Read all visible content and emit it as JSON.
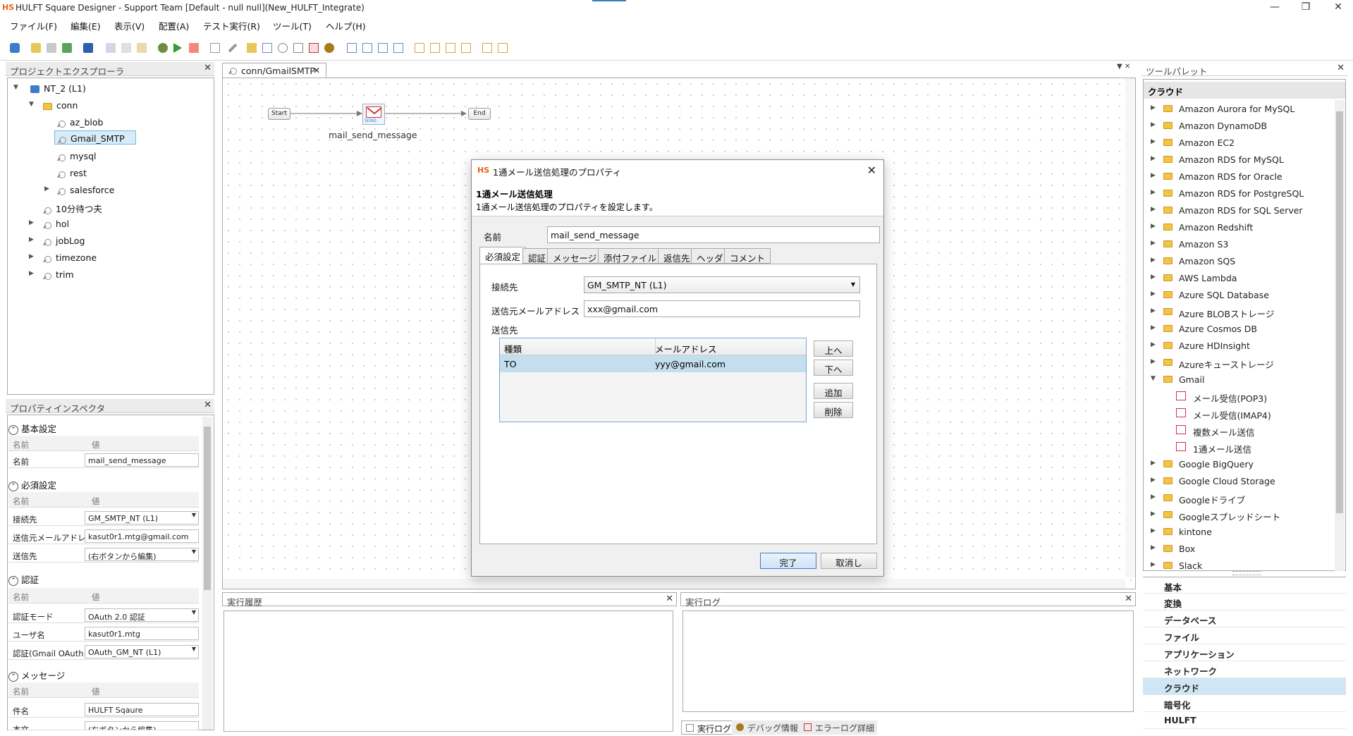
{
  "window": {
    "logo": "HS",
    "title": "HULFT Square Designer - Support Team [Default - null null](New_HULFT_Integrate)"
  },
  "menu": [
    "ファイル(F)",
    "編集(E)",
    "表示(V)",
    "配置(A)",
    "テスト実行(R)",
    "ツール(T)",
    "ヘルプ(H)"
  ],
  "project_explorer": {
    "title": "プロジェクトエクスプローラ",
    "root": "NT_2 (L1)",
    "folder": "conn",
    "children": [
      "az_blob",
      "Gmail_SMTP",
      "mysql",
      "rest",
      "salesforce"
    ],
    "selected": "Gmail_SMTP",
    "others": [
      "10分待つ夫",
      "hol",
      "jobLog",
      "timezone",
      "trim"
    ]
  },
  "inspector": {
    "title": "プロパティインスペクタ",
    "col_name": "名前",
    "col_value": "値",
    "sections": {
      "basic": {
        "title": "基本設定",
        "rows": [
          {
            "k": "名前",
            "v": "mail_send_message"
          }
        ]
      },
      "required": {
        "title": "必須設定",
        "rows": [
          {
            "k": "接続先",
            "v": "GM_SMTP_NT (L1)"
          },
          {
            "k": "送信元メールアドレ",
            "v": "kasut0r1.mtg@gmail.com"
          },
          {
            "k": "送信先",
            "v": "(右ボタンから編集)"
          }
        ]
      },
      "auth": {
        "title": "認証",
        "rows": [
          {
            "k": "認証モード",
            "v": "OAuth 2.0 認証"
          },
          {
            "k": "ユーザ名",
            "v": "kasut0r1.mtg"
          },
          {
            "k": "認証(Gmail OAuth",
            "v": "OAuth_GM_NT (L1)"
          }
        ]
      },
      "message": {
        "title": "メッセージ",
        "rows": [
          {
            "k": "件名",
            "v": "HULFT Sqaure"
          },
          {
            "k": "本文",
            "v": "(右ボタンから編集)"
          }
        ]
      }
    }
  },
  "editor": {
    "tab": "conn/GmailSMTP",
    "flow": {
      "start": "Start",
      "end": "End",
      "node_label": "mail_send_message",
      "node_icon_text": "SEND"
    }
  },
  "bottom": {
    "history_title": "実行履歴",
    "log_title": "実行ログ",
    "tabs": [
      "実行ログ",
      "デバッグ情報",
      "エラーログ詳細"
    ]
  },
  "palette": {
    "title": "ツールパレット",
    "section": "クラウド",
    "items": [
      "Amazon Aurora for MySQL",
      "Amazon DynamoDB",
      "Amazon EC2",
      "Amazon RDS for MySQL",
      "Amazon RDS for Oracle",
      "Amazon RDS for PostgreSQL",
      "Amazon RDS for SQL Server",
      "Amazon Redshift",
      "Amazon S3",
      "Amazon SQS",
      "AWS Lambda",
      "Azure SQL Database",
      "Azure BLOBストレージ",
      "Azure Cosmos DB",
      "Azure HDInsight",
      "Azureキューストレージ"
    ],
    "gmail": "Gmail",
    "gmail_children": [
      "メール受信(POP3)",
      "メール受信(IMAP4)",
      "複数メール送信",
      "1通メール送信"
    ],
    "items_after": [
      "Google BigQuery",
      "Google Cloud Storage",
      "Googleドライブ",
      "Googleスプレッドシート",
      "kintone",
      "Box",
      "Slack"
    ],
    "categories": [
      "基本",
      "変換",
      "データベース",
      "ファイル",
      "アプリケーション",
      "ネットワーク",
      "クラウド",
      "暗号化",
      "HULFT"
    ],
    "selected_category": "クラウド"
  },
  "dialog": {
    "logo": "HS",
    "title": "1通メール送信処理のプロパティ",
    "heading": "1通メール送信処理",
    "description": "1通メール送信処理のプロパティを設定します。",
    "name_label": "名前",
    "name_value": "mail_send_message",
    "tabs": [
      "必須設定",
      "認証",
      "メッセージ",
      "添付ファイル",
      "返信先",
      "ヘッダ",
      "コメント"
    ],
    "connection_label": "接続先",
    "connection_value": "GM_SMTP_NT (L1)",
    "from_label": "送信元メールアドレス",
    "from_value": "xxx@gmail.com",
    "to_label": "送信先",
    "table_headers": [
      "種類",
      "メールアドレス"
    ],
    "table_rows": [
      {
        "type": "TO",
        "address": "yyy@gmail.com"
      }
    ],
    "buttons": {
      "up": "上へ",
      "down": "下へ",
      "add": "追加",
      "delete": "削除",
      "ok": "完了",
      "cancel": "取消し"
    }
  }
}
